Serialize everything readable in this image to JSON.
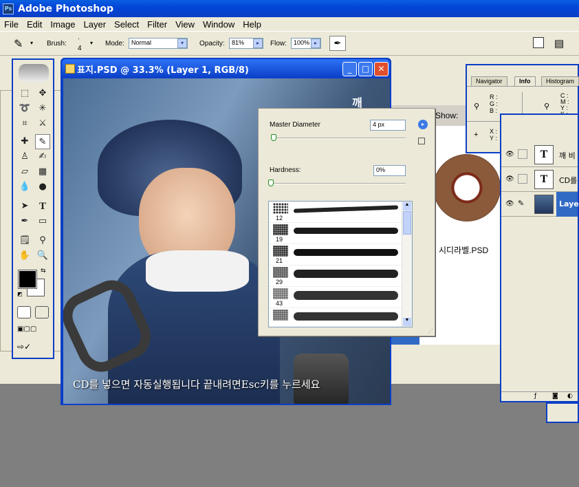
{
  "app": {
    "title": "Adobe Photoshop"
  },
  "menu": [
    "File",
    "Edit",
    "Image",
    "Layer",
    "Select",
    "Filter",
    "View",
    "Window",
    "Help"
  ],
  "options": {
    "brush_label": "Brush:",
    "brush_size": "4",
    "mode_label": "Mode:",
    "mode_value": "Normal",
    "opacity_label": "Opacity:",
    "opacity_value": "81%",
    "flow_label": "Flow:",
    "flow_value": "100%"
  },
  "image_window": {
    "title": "표지.PSD @ 33.3% (Layer 1, RGB/8)",
    "caption": "CD를 넣으면 자동실행됩니다 끝내려면Esc키를 누르세요",
    "corner_text": "깨"
  },
  "brush_popup": {
    "master_diameter_label": "Master Diameter",
    "master_diameter_value": "4 px",
    "hardness_label": "Hardness:",
    "hardness_value": "0%",
    "master_diameter_level": 0.02,
    "hardness_level": 0.0,
    "brushes": [
      {
        "size": "12"
      },
      {
        "size": "19"
      },
      {
        "size": "21"
      },
      {
        "size": "29"
      },
      {
        "size": "43"
      },
      {
        "size": ""
      }
    ]
  },
  "info_panel": {
    "tabs": [
      "Navigator",
      "Info",
      "Histogram"
    ],
    "active_tab": "Info",
    "rgb": [
      "R :",
      "G :",
      "B :"
    ],
    "cmyk": [
      "C :",
      "M :",
      "Y :",
      "K :"
    ],
    "xy": [
      "X :",
      "Y :"
    ],
    "wh": [
      "W :",
      "H :"
    ]
  },
  "layers": [
    {
      "name": "깨 비",
      "type": "text"
    },
    {
      "name": "CD를",
      "type": "text"
    },
    {
      "name": "Layer",
      "type": "image",
      "selected": true
    }
  ],
  "cd_label": {
    "filename": "시디라벨.PSD"
  },
  "background_window": {
    "show_label": "Show:"
  },
  "colors": {
    "title_blue": "#0a3ec6",
    "panel_bg": "#ece9d8",
    "selected_layer": "#316ac5"
  },
  "icons": [
    "photoshop-logo-icon",
    "brush-tool-icon",
    "airbrush-icon",
    "minimize-icon",
    "maximize-icon",
    "close-icon",
    "eyedropper-icon",
    "crosshair-icon",
    "eye-icon",
    "text-layer-icon",
    "flyout-arrow-icon"
  ]
}
